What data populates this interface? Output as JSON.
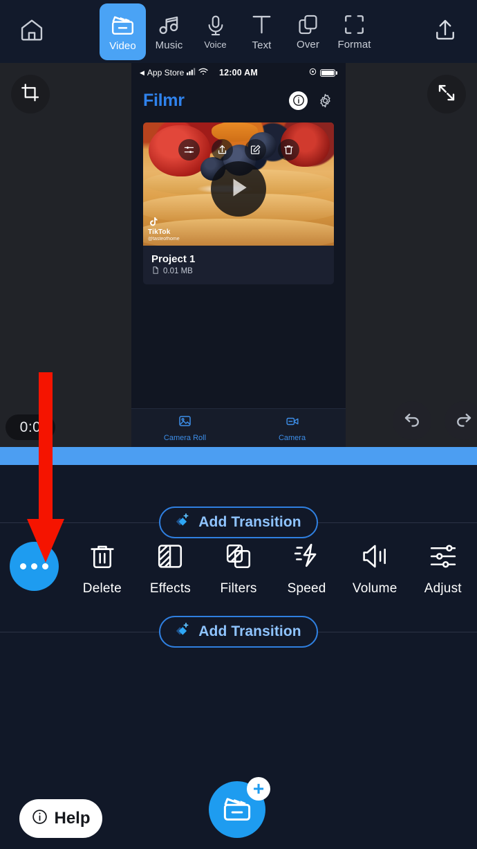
{
  "app": {
    "name": "Filmr",
    "accent": "#1e9cf0",
    "panel_bg": "#111828",
    "stage_bg": "#212328"
  },
  "topnav": {
    "home_icon": "home-icon",
    "upload_icon": "upload-icon",
    "items": [
      {
        "label": "Video",
        "icon": "clapperboard-icon",
        "active": true
      },
      {
        "label": "Music",
        "icon": "music-note-icon",
        "active": false
      },
      {
        "label": "Voice",
        "icon": "microphone-icon",
        "active": false
      },
      {
        "label": "Text",
        "icon": "text-t-icon",
        "active": false
      },
      {
        "label": "Over",
        "icon": "overlay-icon",
        "active": false
      },
      {
        "label": "Format",
        "icon": "format-frame-icon",
        "active": false
      }
    ]
  },
  "stage": {
    "crop_icon": "crop-icon",
    "expand_icon": "expand-icon",
    "undo_icon": "undo-icon",
    "redo_icon": "redo-icon",
    "time_badge": "0:0"
  },
  "phone": {
    "statusbar": {
      "carrier": "App Store",
      "back_arrow": "◀",
      "time": "12:00 AM",
      "signal_icon": "cellular-signal-icon",
      "wifi_icon": "wifi-icon",
      "location_icon": "location-icon",
      "battery_icon": "battery-icon"
    },
    "appbar": {
      "logo": "Filmr",
      "info_icon": "info-icon",
      "settings_icon": "gear-icon"
    },
    "card": {
      "thumb_actions": [
        {
          "name": "adjust-icon"
        },
        {
          "name": "share-icon"
        },
        {
          "name": "edit-icon"
        },
        {
          "name": "trash-icon"
        }
      ],
      "watermark": {
        "brand": "TikTok",
        "user": "@tasteofhome"
      },
      "title": "Project 1",
      "size": "0.01 MB",
      "file_icon": "file-icon",
      "play_icon": "play-icon"
    },
    "bottom_tabs": [
      {
        "label": "Camera Roll",
        "icon": "photo-icon"
      },
      {
        "label": "Camera",
        "icon": "video-camera-icon"
      }
    ]
  },
  "timeline": {
    "handle_icon": "clip-handle-icon",
    "track_color": "#4c9ef2"
  },
  "panel": {
    "transition_top": {
      "label": "Add Transition",
      "icon": "transition-diamond-icon"
    },
    "transition_bottom": {
      "label": "Add Transition",
      "icon": "transition-diamond-icon"
    },
    "tools": [
      {
        "label": "",
        "icon": "more-dots-icon",
        "kind": "more"
      },
      {
        "label": "Delete",
        "icon": "trash-icon"
      },
      {
        "label": "Effects",
        "icon": "effects-icon"
      },
      {
        "label": "Filters",
        "icon": "filters-icon"
      },
      {
        "label": "Speed",
        "icon": "speed-bolt-icon"
      },
      {
        "label": "Volume",
        "icon": "volume-icon"
      },
      {
        "label": "Adjust",
        "icon": "sliders-icon"
      }
    ]
  },
  "footer": {
    "help": {
      "label": "Help",
      "icon": "info-circle-icon"
    },
    "add_media": {
      "icon": "clapperboard-icon",
      "badge": "+"
    }
  },
  "annotation": {
    "arrow": "red-arrow-down",
    "color": "#f51400"
  }
}
